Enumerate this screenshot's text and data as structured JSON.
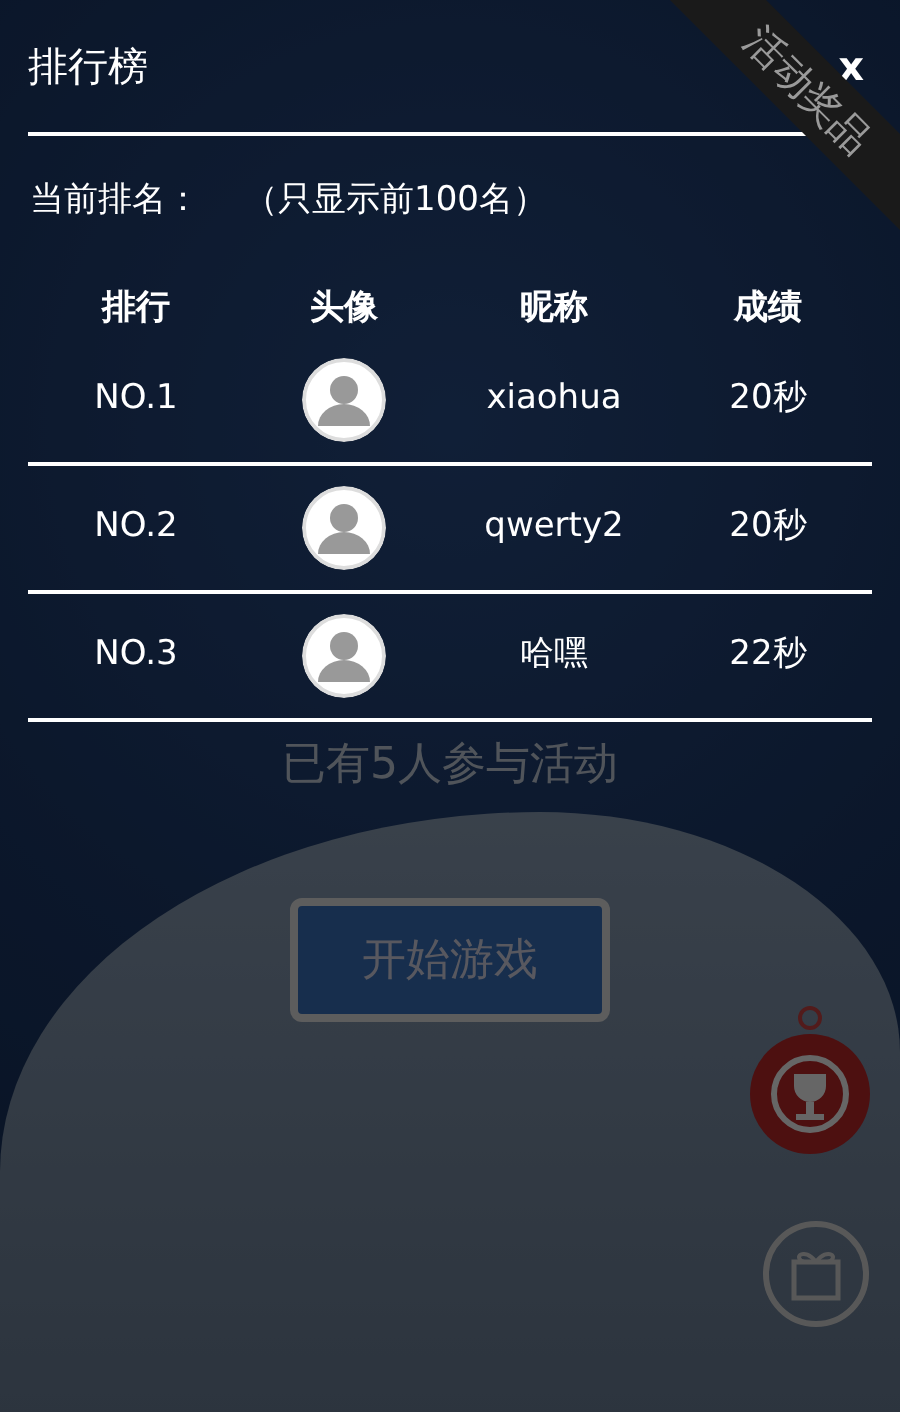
{
  "background": {
    "corner_ribbon": "活动奖品",
    "participants": "已有5人参与活动",
    "start_button": "开始游戏"
  },
  "dialog": {
    "title": "排行榜",
    "close": "x",
    "current_rank_label": "当前排名：",
    "note": "（只显示前100名）",
    "columns": [
      "排行",
      "头像",
      "昵称",
      "成绩"
    ],
    "rows": [
      {
        "rank": "NO.1",
        "nickname": "xiaohua",
        "score": "20秒"
      },
      {
        "rank": "NO.2",
        "nickname": "qwerty2",
        "score": "20秒"
      },
      {
        "rank": "NO.3",
        "nickname": "哈嘿",
        "score": "22秒"
      }
    ]
  }
}
